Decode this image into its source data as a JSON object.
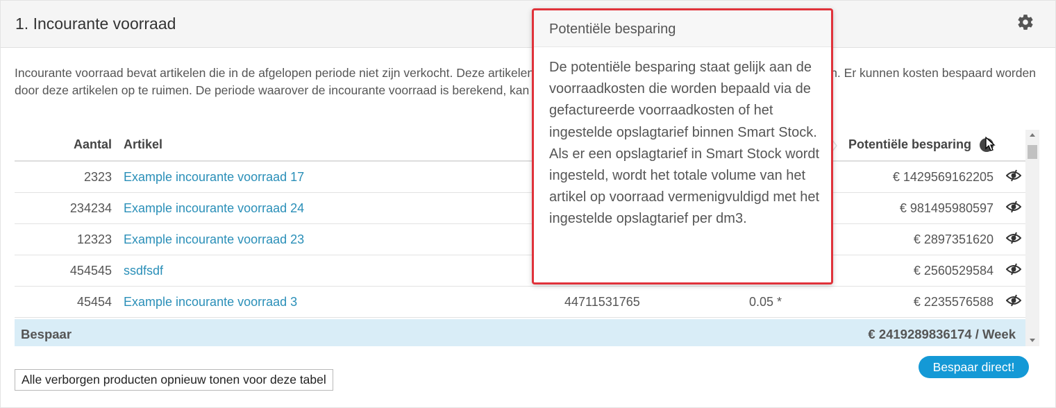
{
  "header": {
    "title": "1. Incourante voorraad"
  },
  "description": "Incourante voorraad bevat artikelen die in de afgelopen periode niet zijn verkocht. Deze artikelen liggen op voorraad en hebben daarmee voorraadkosten. Er kunnen kosten bespaard worden door deze artikelen op te ruimen. De periode waarover de incourante voorraad is berekend, kan worden ingesteld in de instellingen.",
  "table": {
    "columns": {
      "aantal": "Aantal",
      "artikel": "Artikel",
      "besparing": "Potentiële besparing"
    },
    "rows": [
      {
        "aantal": "2323",
        "artikel": "Example incourante voorraad 17",
        "volume": "",
        "tarief": "",
        "besparing": "€ 1429569162205"
      },
      {
        "aantal": "234234",
        "artikel": "Example incourante voorraad 24",
        "volume": "",
        "tarief": "",
        "besparing": "€ 981495980597"
      },
      {
        "aantal": "12323",
        "artikel": "Example incourante voorraad 23",
        "volume": "",
        "tarief": "",
        "besparing": "€ 2897351620"
      },
      {
        "aantal": "454545",
        "artikel": "ssdfsdf",
        "volume": "",
        "tarief": "",
        "besparing": "€ 2560529584"
      },
      {
        "aantal": "45454",
        "artikel": "Example incourante voorraad 3",
        "volume": "44711531765",
        "tarief": "0.05 *",
        "besparing": "€ 2235576588"
      }
    ],
    "total": {
      "label": "Bespaar",
      "value": "€ 2419289836174 / Week"
    }
  },
  "buttons": {
    "show_hidden": "Alle verborgen producten opnieuw tonen voor deze tabel",
    "save_now": "Bespaar direct!"
  },
  "tooltip": {
    "title": "Potentiële besparing",
    "body": "De potentiële besparing staat gelijk aan de voorraadkosten die worden bepaald via de gefactureerde voorraadkosten of het ingestelde opslagtarief binnen Smart Stock. Als er een opslagtarief in Smart Stock wordt ingesteld, wordt het totale volume van het artikel op voorraad vermenigvuldigd met het ingestelde opslagtarief per dm3."
  },
  "colors": {
    "link": "#2a8fb8",
    "accent": "#1499d6",
    "total_bg": "#d9edf7",
    "tooltip_border": "#e0323a"
  }
}
